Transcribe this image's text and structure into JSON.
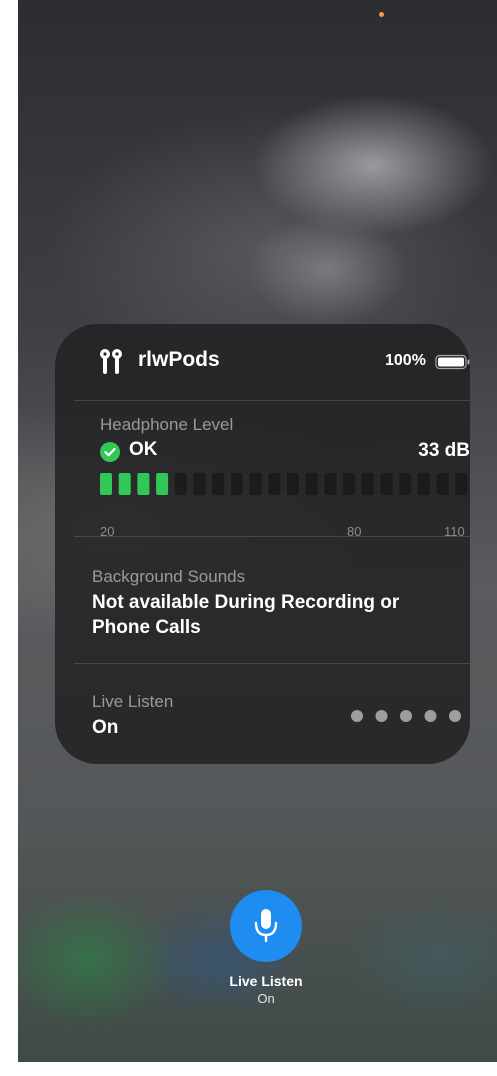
{
  "device": {
    "name": "rlwPods",
    "battery": "100%",
    "icon": "airpods-icon"
  },
  "headphone_level": {
    "title": "Headphone Level",
    "status": "OK",
    "db": "33 dB",
    "level_fraction": 0.2,
    "segments_total": 20,
    "segments_lit": 4,
    "scale": [
      "20",
      "80",
      "110"
    ],
    "lit_color": "#32c759"
  },
  "background_sounds": {
    "title": "Background Sounds",
    "value": "Not available During Recording or Phone Calls"
  },
  "live_listen": {
    "title": "Live Listen",
    "value": "On",
    "level_dots": 5
  },
  "live_listen_button": {
    "label": "Live Listen",
    "state": "On",
    "icon": "microphone-icon",
    "color": "#1e8cf0"
  }
}
